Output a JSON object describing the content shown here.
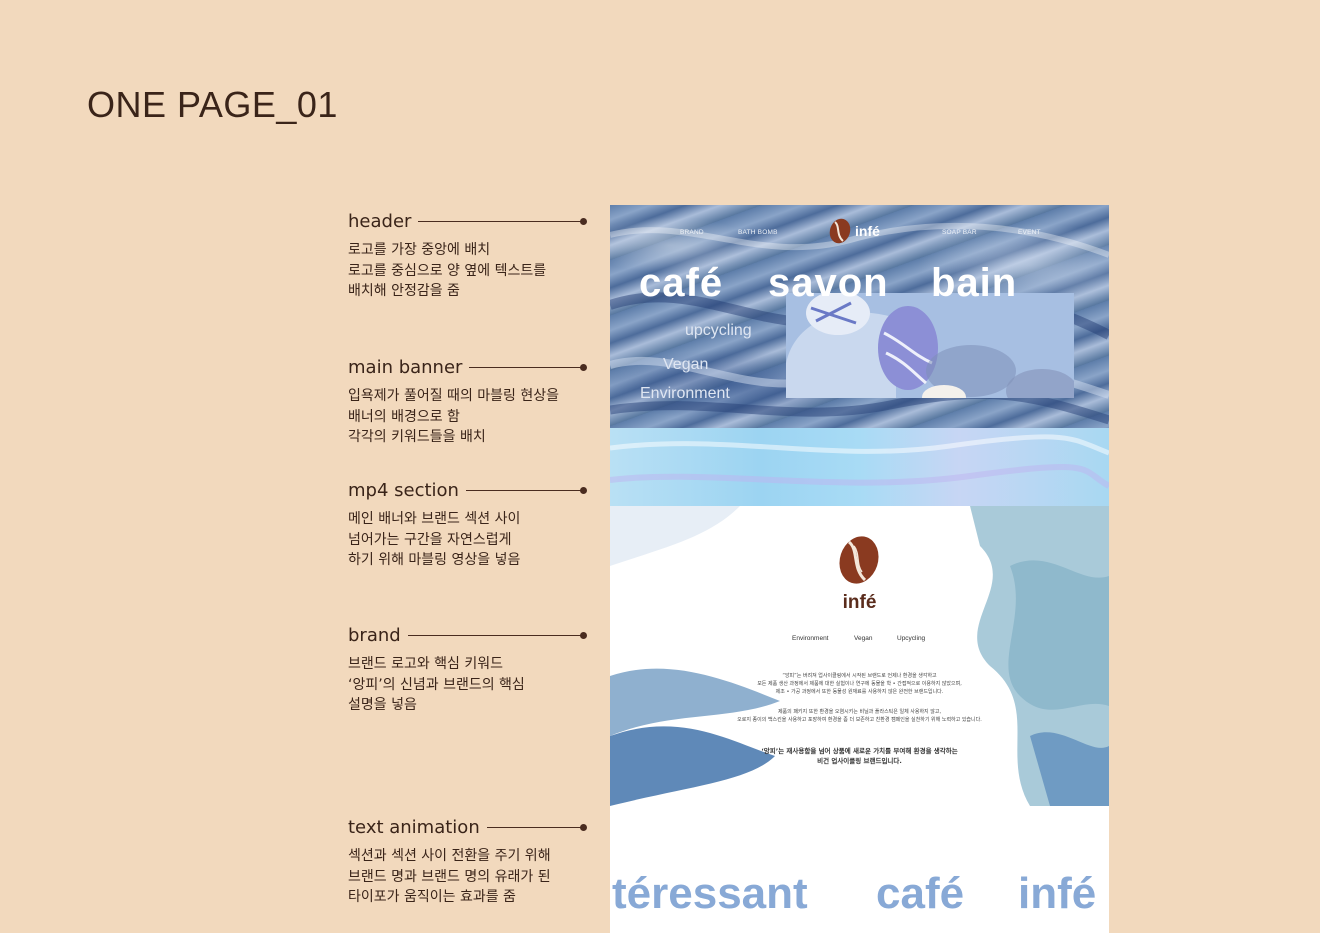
{
  "page_title": "ONE PAGE_01",
  "annotations": [
    {
      "title": "header",
      "lines": [
        "로고를 가장 중앙에 배치",
        "로고를 중심으로 양 옆에 텍스트를",
        "배치해 안정감을 줌"
      ]
    },
    {
      "title": "main banner",
      "lines": [
        "입욕제가 풀어질 때의 마블링 현상을",
        "배너의 배경으로 함",
        "각각의 키워드들을 배치"
      ]
    },
    {
      "title": "mp4 section",
      "lines": [
        "메인 배너와 브랜드 섹션 사이",
        "넘어가는 구간을 자연스럽게",
        "하기 위해 마블링 영상을 넣음"
      ]
    },
    {
      "title": "brand",
      "lines": [
        "브랜드 로고와 핵심 키워드",
        "‘앙피’의 신념과 브랜드의 핵심",
        "설명을 넣음"
      ]
    },
    {
      "title": "text animation",
      "lines": [
        "섹션과 섹션 사이 전환을 주기 위해",
        "브랜드 명과 브랜드 명의 유래가 된",
        "타이포가 움직이는 효과를 줌"
      ]
    }
  ],
  "mockup": {
    "nav": [
      "BRAND",
      "BATH BOMB",
      "SOAP BAR",
      "EVENT"
    ],
    "logo_text": "infé",
    "hero_words": [
      "café",
      "savon",
      "bain"
    ],
    "keywords": [
      "upcycling",
      "Vegan",
      "Environment"
    ],
    "brand": {
      "name": "infé",
      "keywords": [
        "Environment",
        "Vegan",
        "Upcycling"
      ],
      "para1": [
        "“앙피”는 버려져 업사이클링에서 시작된 브랜드로 언제나 환경을 생각하고",
        "모든 제품 생산 과정에서 제품에 대한 실험이나 연구에 동물을 학 • 간접적으로 이용하지 않았으며,",
        "제조 • 가공 과정에서 또한 동물성 원재료를 사용하지 않은 완전한 브랜드입니다."
      ],
      "para2": [
        "제품의 패키지 또한 환경을 오염시키는 비닐과 플라스틱은 일체 사용하지 않고,",
        "오로지 종이의 백스킨을 사용하고 포장하여 환경을 좀 더 보존하고 친환경 캠페인을 실천하기 위해 노력하고 있습니다."
      ],
      "slogan": [
        "‘앙피’는 재사용함을 넘어 상품에 새로운 가치를 부여해 환경을 생각하는",
        "비건 업사이클링 브랜드입니다."
      ]
    },
    "typo_words": [
      "téressant",
      "café",
      "infé"
    ]
  },
  "colors": {
    "background": "#f2d9bd",
    "text": "#3a2419",
    "banner_blue": "#6384b0",
    "brand_brown": "#5a2c1c",
    "typo_blue": "#88a9d6"
  }
}
